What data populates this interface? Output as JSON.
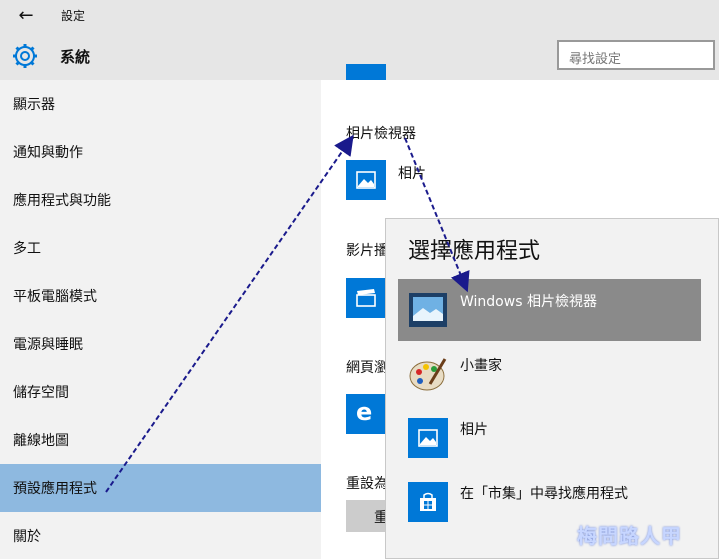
{
  "window": {
    "title": "設定"
  },
  "header": {
    "section": "系統",
    "search_placeholder": "尋找設定"
  },
  "sidebar": {
    "items": [
      {
        "label": "顯示器"
      },
      {
        "label": "通知與動作"
      },
      {
        "label": "應用程式與功能"
      },
      {
        "label": "多工"
      },
      {
        "label": "平板電腦模式"
      },
      {
        "label": "電源與睡眠"
      },
      {
        "label": "儲存空間"
      },
      {
        "label": "離線地圖"
      },
      {
        "label": "預設應用程式"
      },
      {
        "label": "關於"
      }
    ],
    "selected": "預設應用程式"
  },
  "content": {
    "photo_viewer_heading": "相片檢視器",
    "photo_app": "相片",
    "video_heading": "影片播",
    "web_heading": "網頁瀏",
    "reset_heading": "重設為",
    "reset_button": "重"
  },
  "picker": {
    "title": "選擇應用程式",
    "options": [
      {
        "label": "Windows 相片檢視器",
        "icon": "photo-viewer-icon"
      },
      {
        "label": "小畫家",
        "icon": "paint-icon"
      },
      {
        "label": "相片",
        "icon": "photos-icon"
      },
      {
        "label": "在「市集」中尋找應用程式",
        "icon": "store-icon"
      }
    ]
  },
  "watermark": "梅問路人甲",
  "colors": {
    "accent": "#0078d7",
    "selected_nav": "#8eb9e0",
    "selected_option": "#8a8a8a",
    "arrow": "#1a1a8c"
  }
}
